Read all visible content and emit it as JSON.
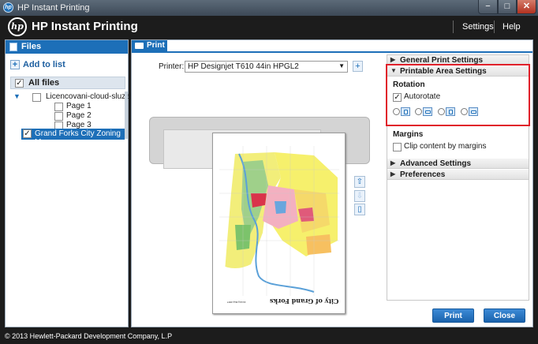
{
  "window": {
    "title": "HP Instant Printing",
    "minimize": "−",
    "maximize": "□",
    "close": "✕"
  },
  "header": {
    "logo": "hp",
    "title": "HP Instant Printing",
    "settings_link": "Settings",
    "help_link": "Help"
  },
  "files_panel": {
    "title": "Files",
    "add_to_list": "Add to list",
    "all_files": "All files",
    "tree": [
      {
        "label": "Licencovani-cloud-sluzeb-A",
        "checked": false,
        "expanded": true
      },
      {
        "label": "Page 1",
        "checked": false
      },
      {
        "label": "Page 2",
        "checked": false
      },
      {
        "label": "Page 3",
        "checked": false
      },
      {
        "label": "Grand Forks City Zoning Ma",
        "checked": true,
        "selected": true
      }
    ]
  },
  "print_tab": {
    "label": "Print",
    "printer_label": "Printer:",
    "printer_value": "HP Designjet T610 44in HPGL2",
    "preview_caption": "City of Grand Forks",
    "preview_subcaption": "Zoning Map 2007"
  },
  "settings": {
    "general": "General Print Settings",
    "printable_area": "Printable Area Settings",
    "rotation_heading": "Rotation",
    "autorotate_label": "Autorotate",
    "autorotate_checked": true,
    "rotation_options": [
      "rotate-0-icon",
      "rotate-90-icon",
      "rotate-180-icon",
      "rotate-270-icon"
    ],
    "margins_heading": "Margins",
    "clip_label": "Clip content by margins",
    "clip_checked": false,
    "advanced": "Advanced Settings",
    "preferences": "Preferences"
  },
  "actions": {
    "print_button": "Print",
    "close_button": "Close"
  },
  "footer": {
    "copyright": "© 2013 Hewlett-Packard Development Company, L.P"
  },
  "colors": {
    "accent": "#1d6fb8",
    "chrome": "#1c1c1c",
    "highlight": "#e0202a"
  }
}
